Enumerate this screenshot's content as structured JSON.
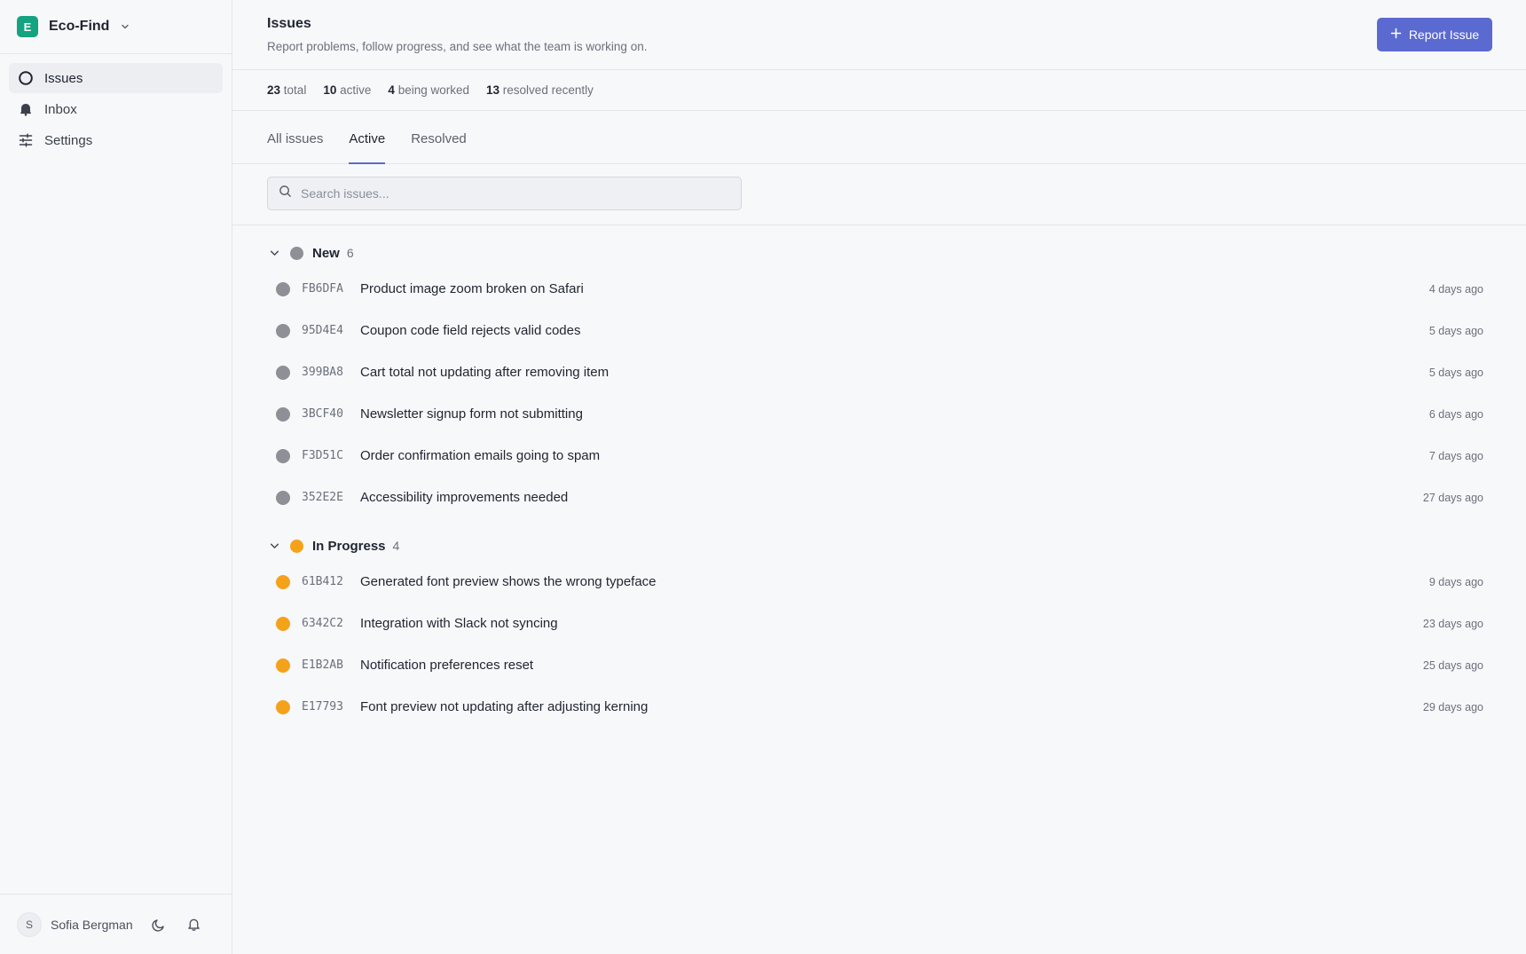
{
  "colors": {
    "accent": "#5b6ad0",
    "workspace_logo": "#13a37f",
    "status_new": "#8e9097",
    "status_in_progress": "#f5a21b"
  },
  "workspace": {
    "initial": "E",
    "name": "Eco-Find",
    "icon": "chevron-down-icon"
  },
  "sidebar": {
    "items": [
      {
        "label": "Issues",
        "icon": "circle-icon",
        "active": true
      },
      {
        "label": "Inbox",
        "icon": "bell-icon",
        "active": false
      },
      {
        "label": "Settings",
        "icon": "sliders-icon",
        "active": false
      }
    ],
    "footer": {
      "avatar_initial": "S",
      "user_name": "Sofia Bergman"
    }
  },
  "header": {
    "title": "Issues",
    "subtitle": "Report problems, follow progress, and see what the team is working on.",
    "report_button": "Report Issue"
  },
  "stats": [
    {
      "value": "23",
      "label": "total"
    },
    {
      "value": "10",
      "label": "active"
    },
    {
      "value": "4",
      "label": "being worked"
    },
    {
      "value": "13",
      "label": "resolved recently"
    }
  ],
  "tabs": [
    {
      "label": "All issues",
      "active": false
    },
    {
      "label": "Active",
      "active": true
    },
    {
      "label": "Resolved",
      "active": false
    }
  ],
  "search": {
    "placeholder": "Search issues..."
  },
  "groups": [
    {
      "name": "New",
      "count": "6",
      "status": "new",
      "issues": [
        {
          "id": "FB6DFA",
          "title": "Product image zoom broken on Safari",
          "time": "4 days ago"
        },
        {
          "id": "95D4E4",
          "title": "Coupon code field rejects valid codes",
          "time": "5 days ago"
        },
        {
          "id": "399BA8",
          "title": "Cart total not updating after removing item",
          "time": "5 days ago"
        },
        {
          "id": "3BCF40",
          "title": "Newsletter signup form not submitting",
          "time": "6 days ago"
        },
        {
          "id": "F3D51C",
          "title": "Order confirmation emails going to spam",
          "time": "7 days ago"
        },
        {
          "id": "352E2E",
          "title": "Accessibility improvements needed",
          "time": "27 days ago"
        }
      ]
    },
    {
      "name": "In Progress",
      "count": "4",
      "status": "in_progress",
      "issues": [
        {
          "id": "61B412",
          "title": "Generated font preview shows the wrong typeface",
          "time": "9 days ago"
        },
        {
          "id": "6342C2",
          "title": "Integration with Slack not syncing",
          "time": "23 days ago"
        },
        {
          "id": "E1B2AB",
          "title": "Notification preferences reset",
          "time": "25 days ago"
        },
        {
          "id": "E17793",
          "title": "Font preview not updating after adjusting kerning",
          "time": "29 days ago"
        }
      ]
    }
  ]
}
